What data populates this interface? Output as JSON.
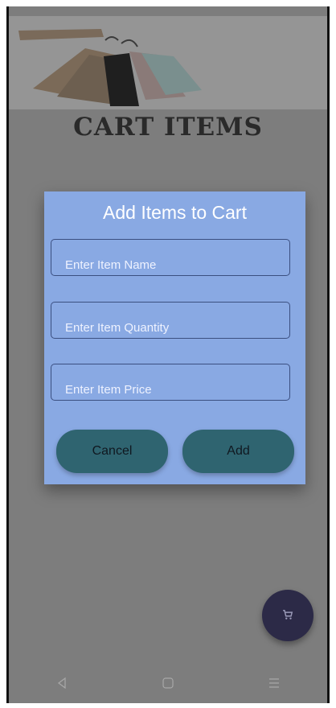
{
  "page": {
    "title": "CART ITEMS"
  },
  "dialog": {
    "title": "Add Items to Cart",
    "fields": {
      "name": {
        "value": "",
        "placeholder": "Enter Item Name"
      },
      "quantity": {
        "value": "",
        "placeholder": "Enter Item Quantity"
      },
      "price": {
        "value": "",
        "placeholder": "Enter Item Price"
      }
    },
    "buttons": {
      "cancel": "Cancel",
      "add": "Add"
    }
  },
  "fab": {
    "icon": "cart-icon"
  },
  "navbar": {
    "icons": [
      "back-icon",
      "home-icon",
      "recents-icon"
    ]
  },
  "colors": {
    "dialog": "#89a9e3",
    "button": "#2f6470",
    "fab": "#2c2a47",
    "scrim": "#7d7d7d"
  }
}
